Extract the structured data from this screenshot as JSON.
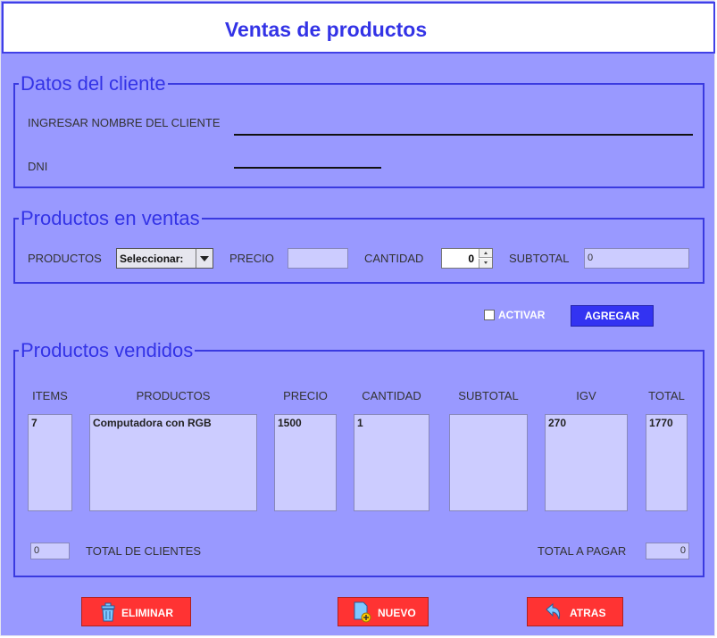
{
  "header": {
    "title": "Ventas de productos"
  },
  "cliente": {
    "legend": "Datos del cliente",
    "name_label": "INGRESAR NOMBRE DEL CLIENTE",
    "name_value": "",
    "dni_label": "DNI",
    "dni_value": ""
  },
  "productos_en_ventas": {
    "legend": "Productos en ventas",
    "productos_label": "PRODUCTOS",
    "productos_selected": "Seleccionar:",
    "precio_label": "PRECIO",
    "precio_value": "",
    "cantidad_label": "CANTIDAD",
    "cantidad_value": "0",
    "subtotal_label": "SUBTOTAL",
    "subtotal_value": "0"
  },
  "actions": {
    "activar_label": "ACTIVAR",
    "agregar_label": "AGREGAR"
  },
  "productos_vendidos": {
    "legend": "Productos vendidos",
    "columns": [
      "ITEMS",
      "PRODUCTOS",
      "PRECIO",
      "CANTIDAD",
      "SUBTOTAL",
      "IGV",
      "TOTAL"
    ],
    "values": {
      "items": "7",
      "productos": "Computadora con RGB",
      "precio": "1500",
      "cantidad": "1",
      "subtotal": "",
      "igv": "270",
      "total": "1770"
    },
    "total_clientes_value": "0",
    "total_clientes_label": "TOTAL DE CLIENTES",
    "total_pagar_label": "TOTAL A PAGAR",
    "total_pagar_value": "0"
  },
  "footer": {
    "eliminar_label": "ELIMINAR",
    "nuevo_label": "NUEVO",
    "atras_label": "ATRAS"
  },
  "colors": {
    "background": "#9999ff",
    "accent": "#3333e6",
    "button_red": "#ff3333",
    "button_blue": "#3333f2",
    "field_fill": "#ccccff"
  }
}
